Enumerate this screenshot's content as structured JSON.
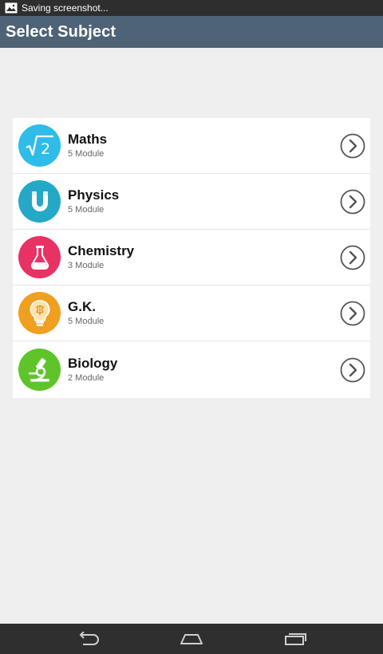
{
  "status_bar": {
    "notification_text": "Saving screenshot..."
  },
  "app_bar": {
    "title": "Select Subject"
  },
  "subjects": [
    {
      "name": "Maths",
      "modules": "5 Module",
      "icon": "square-root-icon",
      "color": "#2fbce9"
    },
    {
      "name": "Physics",
      "modules": "5 Module",
      "icon": "magnet-icon",
      "color": "#25a8c6"
    },
    {
      "name": "Chemistry",
      "modules": "3 Module",
      "icon": "flask-icon",
      "color": "#e83263"
    },
    {
      "name": "G.K.",
      "modules": "5 Module",
      "icon": "lightbulb-icon",
      "color": "#f0a020"
    },
    {
      "name": "Biology",
      "modules": "2 Module",
      "icon": "microscope-icon",
      "color": "#5fc42a"
    }
  ],
  "nav_bar": {
    "buttons": [
      "back-icon",
      "home-icon",
      "recent-apps-icon"
    ]
  }
}
